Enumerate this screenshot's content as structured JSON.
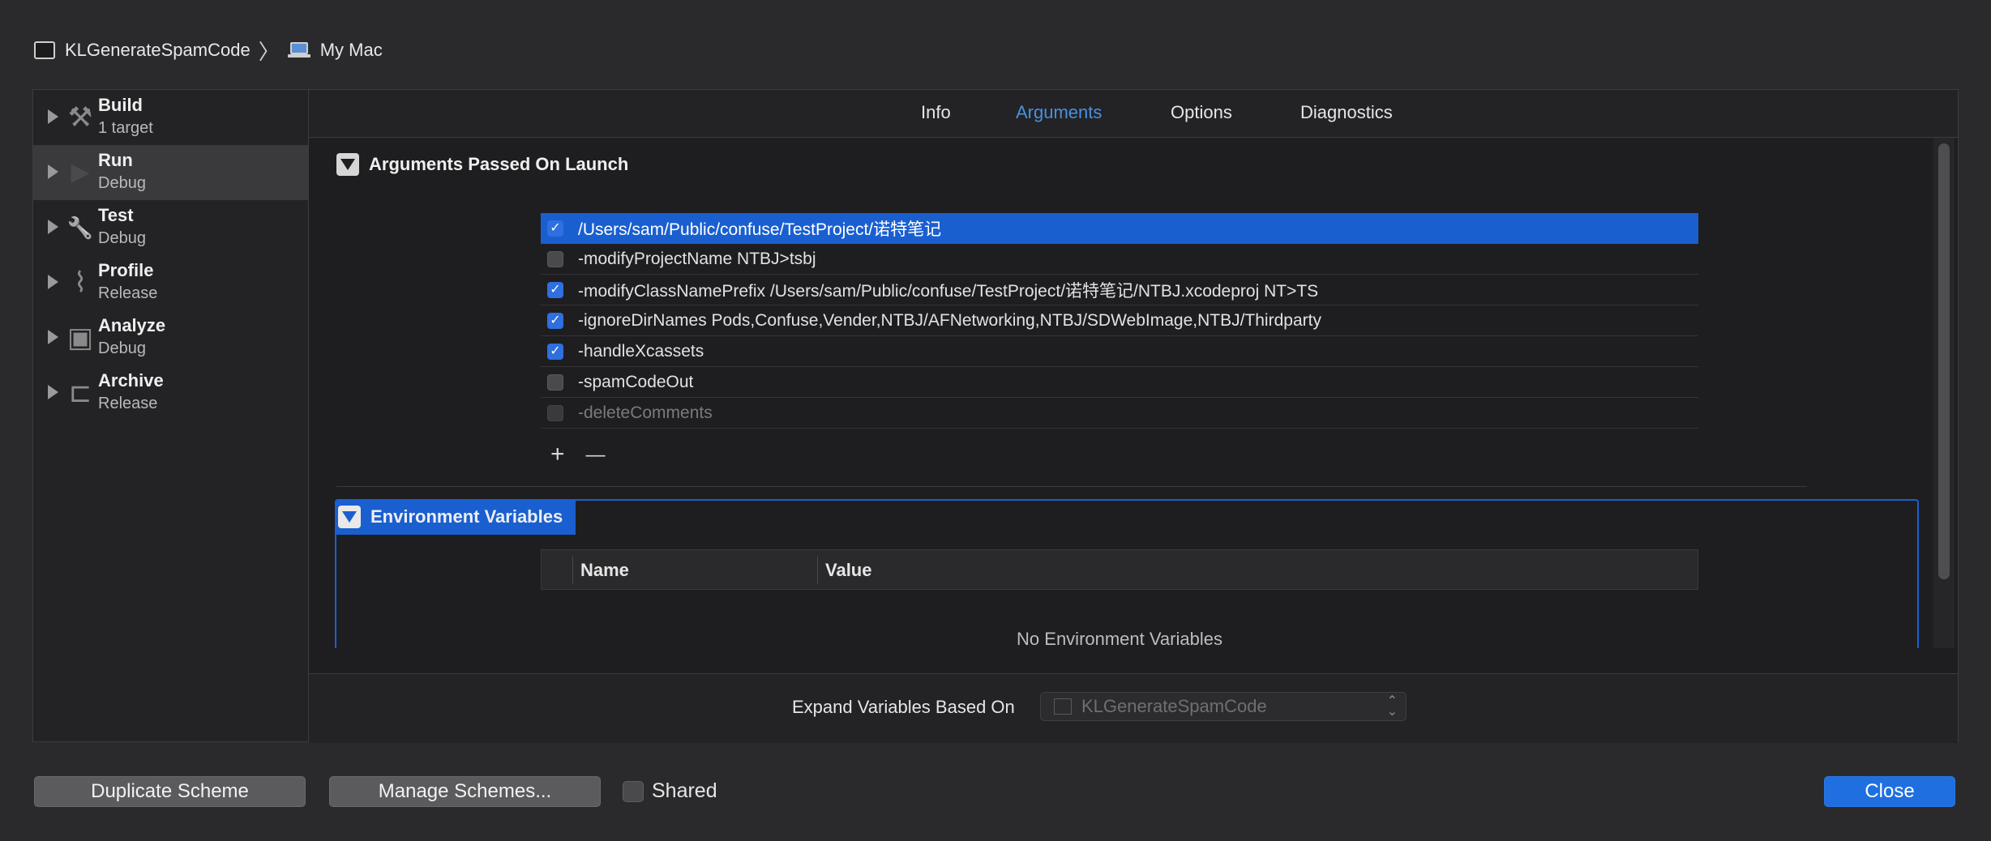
{
  "breadcrumb": {
    "project": "KLGenerateSpamCode",
    "separator": "〉",
    "destination": "My Mac"
  },
  "sidebar": {
    "items": [
      {
        "title": "Build",
        "subtitle": "1 target",
        "icon": "hammer-icon",
        "glyph": "⚒",
        "selected": false
      },
      {
        "title": "Run",
        "subtitle": "Debug",
        "icon": "play-icon",
        "glyph": "▶",
        "selected": true
      },
      {
        "title": "Test",
        "subtitle": "Debug",
        "icon": "wrench-icon",
        "glyph": "🔧",
        "selected": false
      },
      {
        "title": "Profile",
        "subtitle": "Release",
        "icon": "gauge-icon",
        "glyph": "⌇",
        "selected": false
      },
      {
        "title": "Analyze",
        "subtitle": "Debug",
        "icon": "analyze-icon",
        "glyph": "▣",
        "selected": false
      },
      {
        "title": "Archive",
        "subtitle": "Release",
        "icon": "archive-icon",
        "glyph": "⊏",
        "selected": false
      }
    ]
  },
  "tabs": [
    {
      "label": "Info",
      "active": false
    },
    {
      "label": "Arguments",
      "active": true
    },
    {
      "label": "Options",
      "active": false
    },
    {
      "label": "Diagnostics",
      "active": false
    }
  ],
  "arguments_section": {
    "title": "Arguments Passed On Launch",
    "rows": [
      {
        "text": "/Users/sam/Public/confuse/TestProject/诺特笔记",
        "checked": true,
        "selected": true
      },
      {
        "text": "-modifyProjectName NTBJ>tsbj",
        "checked": false,
        "selected": false
      },
      {
        "text": "-modifyClassNamePrefix /Users/sam/Public/confuse/TestProject/诺特笔记/NTBJ.xcodeproj NT>TS",
        "checked": true,
        "selected": false
      },
      {
        "text": "-ignoreDirNames Pods,Confuse,Vender,NTBJ/AFNetworking,NTBJ/SDWebImage,NTBJ/Thirdparty",
        "checked": true,
        "selected": false
      },
      {
        "text": "-handleXcassets",
        "checked": true,
        "selected": false
      },
      {
        "text": "-spamCodeOut",
        "checked": false,
        "selected": false
      },
      {
        "text": "-deleteComments",
        "checked": false,
        "selected": false,
        "dim": true
      }
    ],
    "add_label": "+",
    "remove_label": "—"
  },
  "environment_section": {
    "title": "Environment Variables",
    "col_name": "Name",
    "col_value": "Value",
    "empty_text": "No Environment Variables"
  },
  "bottom": {
    "expand_label": "Expand Variables Based On",
    "expand_value": "KLGenerateSpamCode"
  },
  "footer": {
    "duplicate": "Duplicate Scheme",
    "manage": "Manage Schemes...",
    "shared": "Shared",
    "close": "Close"
  },
  "colors": {
    "accent": "#1a5fd0",
    "tab_active": "#4a90e2",
    "background": "#2a2a2c"
  }
}
